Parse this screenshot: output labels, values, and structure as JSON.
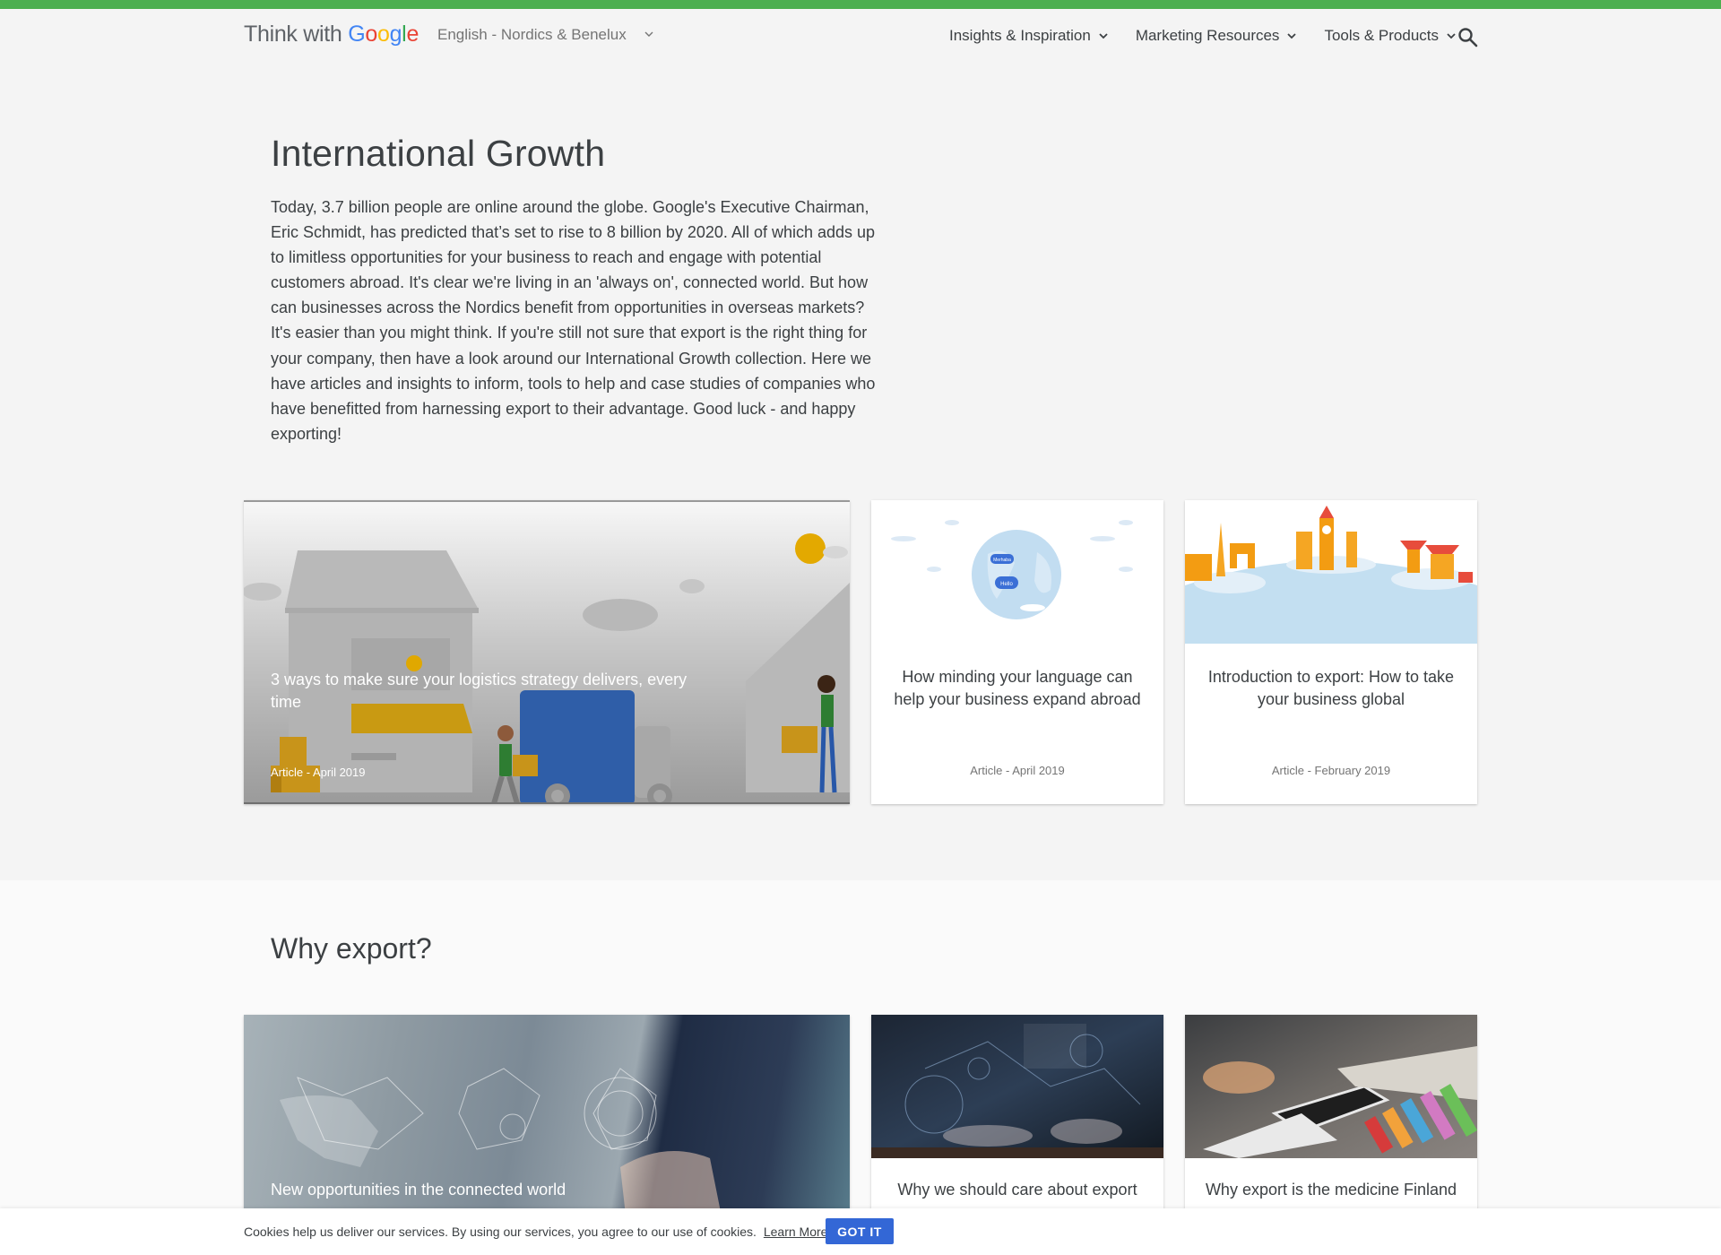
{
  "colors": {
    "top_bar": "#4caf50",
    "accent_blue": "#3367d6"
  },
  "header": {
    "logo": {
      "prefix": "Think with ",
      "brand_letters": [
        "G",
        "o",
        "o",
        "g",
        "l",
        "e"
      ]
    },
    "language_selector": {
      "selected": "English - Nordics & Benelux",
      "icon": "chevron-down-icon"
    },
    "nav": [
      {
        "label": "Insights & Inspiration",
        "icon": "chevron-down-icon"
      },
      {
        "label": "Marketing Resources",
        "icon": "chevron-down-icon"
      },
      {
        "label": "Tools & Products",
        "icon": "chevron-down-icon"
      }
    ],
    "search_icon": "search-icon"
  },
  "hero": {
    "title": "International Growth",
    "body": "Today, 3.7 billion people are online around the globe. Google's Executive Chairman, Eric Schmidt, has predicted that’s set to rise to 8 billion by 2020. All of which adds up to limitless opportunities for your business to reach and engage with potential customers abroad. It's clear we're living in an 'always on', connected world. But how can businesses across the Nordics benefit from opportunities in overseas markets? It's easier than you might think. If you're still not sure that export is the right thing for your company, then have a look around our International Growth collection. Here we have articles and insights to inform, tools to help and case studies of companies who have benefitted from harnessing export to their advantage. Good luck - and happy exporting!"
  },
  "featured_cards": [
    {
      "title": "3 ways to make sure your logistics strategy delivers, every time",
      "meta": "Article - April 2019",
      "image": "logistics-illustration"
    },
    {
      "title": "How minding your language can help your business expand abroad",
      "meta": "Article - April 2019",
      "image": "globe-illustration",
      "bubbles": [
        "Merhaba",
        "Hello"
      ]
    },
    {
      "title": "Introduction to export: How to take your business global",
      "meta": "Article - February 2019",
      "image": "landmarks-illustration"
    }
  ],
  "why_export": {
    "title": "Why export?",
    "cards": [
      {
        "title": "New opportunities in the connected world",
        "image": "network-photo"
      },
      {
        "title": "Why we should care about export",
        "image": "tech-hands-photo"
      },
      {
        "title": "Why export is the medicine Finland",
        "image": "tablet-desk-photo"
      }
    ]
  },
  "cookie_bar": {
    "message": "Cookies help us deliver our services. By using our services, you agree to our use of cookies.",
    "learn_more": "Learn More",
    "button": "GOT IT"
  }
}
